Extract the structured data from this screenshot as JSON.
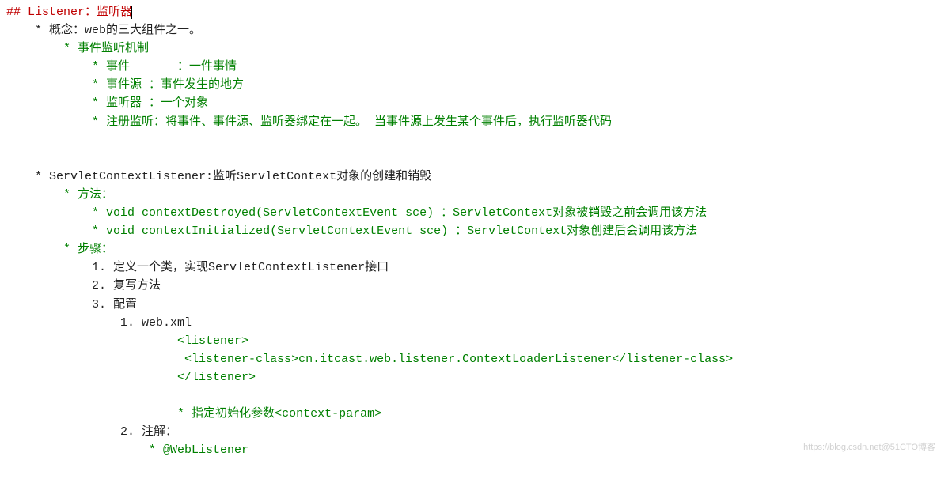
{
  "title_prefix": "## Listener：",
  "title_suffix": "监听器",
  "concept_line": "* 概念：web的三大组件之一。",
  "mech_title": "* 事件监听机制",
  "mech_event": "* 事件\t：一件事情",
  "mech_source": "* 事件源 ：事件发生的地方",
  "mech_listener": "* 监听器 ：一个对象",
  "mech_register": "* 注册监听：将事件、事件源、监听器绑定在一起。 当事件源上发生某个事件后，执行监听器代码",
  "scl_line": "* ServletContextListener:监听ServletContext对象的创建和销毁",
  "method_label": "* 方法：",
  "method_destroyed": "* void contextDestroyed(ServletContextEvent sce) ：ServletContext对象被销毁之前会调用该方法",
  "method_init": "* void contextInitialized(ServletContextEvent sce) ：ServletContext对象创建后会调用该方法",
  "steps_label": "* 步骤：",
  "step1": "1. 定义一个类，实现ServletContextListener接口",
  "step2": "2. 复写方法",
  "step3": "3. 配置",
  "webxml_label": "1. web.xml",
  "xml_open": "<listener>",
  "xml_class_open": " <listener-class>",
  "xml_class_text": "cn.itcast.web.listener.ContextLoaderListener",
  "xml_class_close": "</listener-class>",
  "xml_close": "</listener>",
  "init_param_prefix": "* 指定初始化参数",
  "init_param_tag": "<context-param>",
  "annot_label": "2. 注解：",
  "annot_value": "* @WebListener",
  "watermark": "https://blog.csdn.net@51CTO博客"
}
